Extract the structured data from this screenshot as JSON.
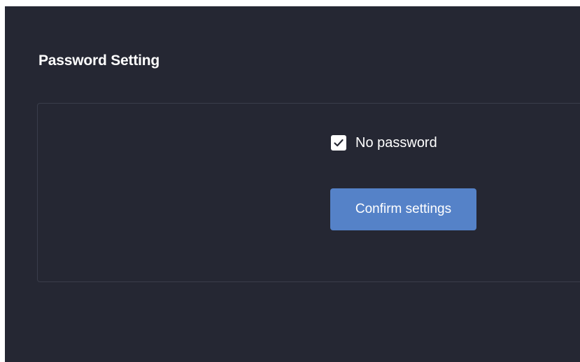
{
  "panel": {
    "title": "Password Setting"
  },
  "settings": {
    "no_password": {
      "label": "No password",
      "checked": true
    },
    "confirm_label": "Confirm settings"
  },
  "icons": {
    "checkbox_mark": "checkmark-icon"
  },
  "colors": {
    "background": "#252733",
    "accent": "#5582c8",
    "text": "#ffffff",
    "card_border": "#3a3d4b"
  }
}
